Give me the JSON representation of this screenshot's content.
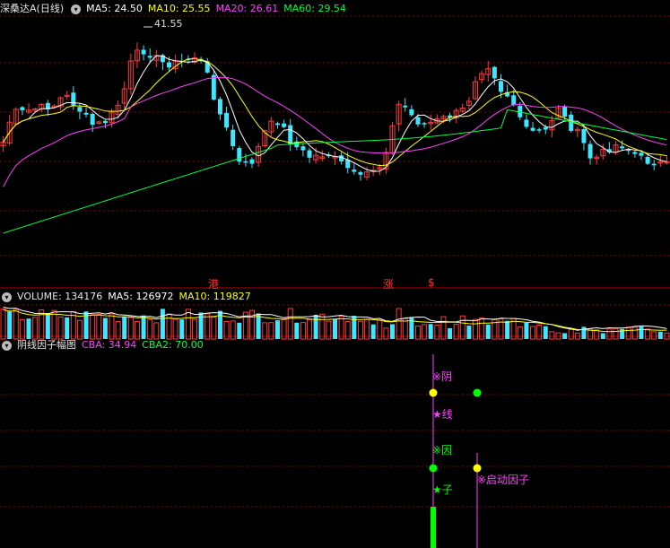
{
  "colors": {
    "up": "#ff3b3b",
    "down": "#3fe6ff",
    "ma5": "#ffffff",
    "ma10": "#ffff00",
    "ma20": "#ff40ff",
    "ma60": "#00ff40",
    "vol_ma5": "#ffffff",
    "vol_ma10": "#ffff00",
    "grid": "#8b0000",
    "signal_green": "#00ff00",
    "signal_yellow": "#ffff00",
    "signal_magenta": "#ff40ff"
  },
  "header_main": {
    "icon": "chevron-down-icon",
    "name": "深桑达A",
    "period": "(日线)",
    "ma5": "MA5: 24.50",
    "ma10": "MA10: 25.55",
    "ma20": "MA20: 26.61",
    "ma60": "MA60: 29.54"
  },
  "header_volume": {
    "icon": "chevron-down-icon",
    "volume": "VOLUME: 134176",
    "ma5": "MA5: 126972",
    "ma10": "MA10: 119827"
  },
  "header_factor": {
    "icon": "chevron-down-icon",
    "name": "阴线因子幅图",
    "cba": "CBA: 34.94",
    "cba2": "CBA2: 70.00"
  },
  "peak_label": "41.55",
  "markers": {
    "m1": "港",
    "m2": "涨",
    "m3": "$"
  },
  "signals": {
    "s1": "※阴",
    "s2": "★线",
    "s3": "※因",
    "s4": "★子",
    "s5": "※启动因子"
  },
  "chart_data": {
    "type": "candlestick",
    "series_names": [
      "MA5",
      "MA10",
      "MA20",
      "MA60"
    ],
    "visible_price_max": 41.55,
    "volume": {
      "latest": 134176,
      "ma5": 126972,
      "ma10": 119827
    },
    "indicator": {
      "CBA": 34.94,
      "CBA2": 70.0
    }
  }
}
